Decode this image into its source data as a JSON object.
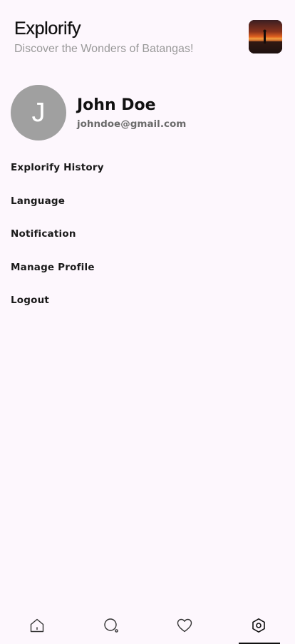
{
  "header": {
    "title": "Explorify",
    "subtitle": "Discover the Wonders of Batangas!",
    "thumbnail": "sunset-photo"
  },
  "profile": {
    "initial": "J",
    "name": "John Doe",
    "email": "johndoe@gmail.com",
    "avatar_color": "#a0a0a0"
  },
  "menu": {
    "items": [
      {
        "label": "Explorify History"
      },
      {
        "label": "Language"
      },
      {
        "label": "Notification"
      },
      {
        "label": "Manage Profile"
      },
      {
        "label": "Logout"
      }
    ]
  },
  "bottom_nav": {
    "items": [
      {
        "icon": "home-icon",
        "active": false
      },
      {
        "icon": "search-icon",
        "active": false
      },
      {
        "icon": "heart-icon",
        "active": false
      },
      {
        "icon": "settings-icon",
        "active": true
      }
    ],
    "active_index": 3
  },
  "colors": {
    "background": "#fdf7fd",
    "text_primary": "#111111",
    "text_secondary": "#9a9a9a",
    "accent": "#111111"
  }
}
